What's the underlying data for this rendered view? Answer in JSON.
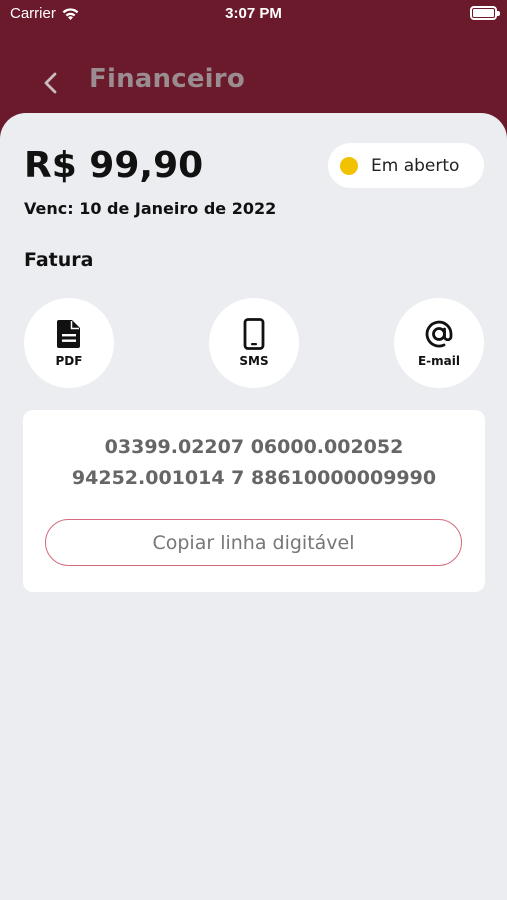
{
  "status_bar": {
    "carrier": "Carrier",
    "time": "3:07 PM",
    "battery_level": 1.0
  },
  "header": {
    "back_icon": "chevron-left-icon",
    "title": "Financeiro"
  },
  "invoice": {
    "amount": "R$ 99,90",
    "due_date": "Venc: 10 de Janeiro de 2022",
    "status": {
      "label": "Em aberto",
      "color": "#f2c200"
    }
  },
  "section": {
    "title": "Fatura"
  },
  "actions": [
    {
      "label": "PDF",
      "icon": "document-icon"
    },
    {
      "label": "SMS",
      "icon": "phone-icon"
    },
    {
      "label": "E-mail",
      "icon": "at-sign-icon"
    }
  ],
  "barcode": {
    "line1": "03399.02207 06000.002052",
    "line2": "94252.001014 7 88610000009990",
    "copy_label": "Copiar linha digitável"
  },
  "colors": {
    "brand": "#6b1a2b",
    "background": "#ebedf0",
    "accent_border": "#d56a7d"
  }
}
